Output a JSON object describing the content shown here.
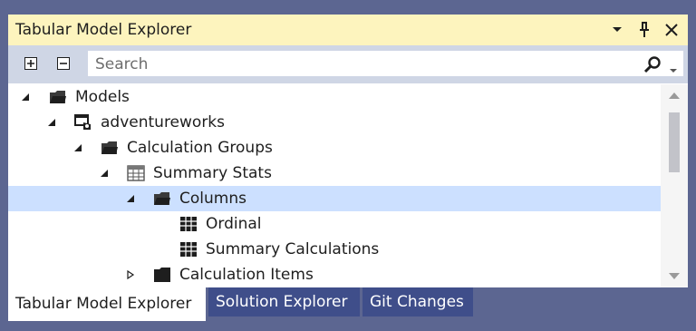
{
  "window": {
    "title": "Tabular Model Explorer"
  },
  "title_buttons": [
    "dropdown-icon",
    "pin-icon",
    "close-icon"
  ],
  "toolbar": {
    "expand_icon": "expand-all-icon",
    "collapse_icon": "collapse-all-icon"
  },
  "search": {
    "placeholder": "Search",
    "value": ""
  },
  "tree": {
    "items": [
      {
        "label": "Models",
        "icon": "folder-icon",
        "state": "expanded",
        "level": 0
      },
      {
        "label": "adventureworks",
        "icon": "model-icon",
        "state": "expanded",
        "level": 1
      },
      {
        "label": "Calculation Groups",
        "icon": "folder-icon",
        "state": "expanded",
        "level": 2
      },
      {
        "label": "Summary Stats",
        "icon": "table-icon",
        "state": "expanded",
        "level": 3
      },
      {
        "label": "Columns",
        "icon": "folder-icon",
        "state": "expanded",
        "level": 4,
        "selected": true
      },
      {
        "label": "Ordinal",
        "icon": "column-icon",
        "state": "leaf",
        "level": 5
      },
      {
        "label": "Summary Calculations",
        "icon": "column-icon",
        "state": "leaf",
        "level": 5
      },
      {
        "label": "Calculation Items",
        "icon": "folder-icon",
        "state": "collapsed",
        "level": 4
      }
    ]
  },
  "tabs": [
    {
      "label": "Tabular Model Explorer",
      "active": true
    },
    {
      "label": "Solution Explorer",
      "active": false
    },
    {
      "label": "Git Changes",
      "active": false
    }
  ],
  "colors": {
    "title_bg": "#fdf4be",
    "frame": "#5c6691",
    "toolbar_bg": "#cfd6e5",
    "selection": "#cce0ff",
    "tab_inactive": "#3f4e8a"
  }
}
